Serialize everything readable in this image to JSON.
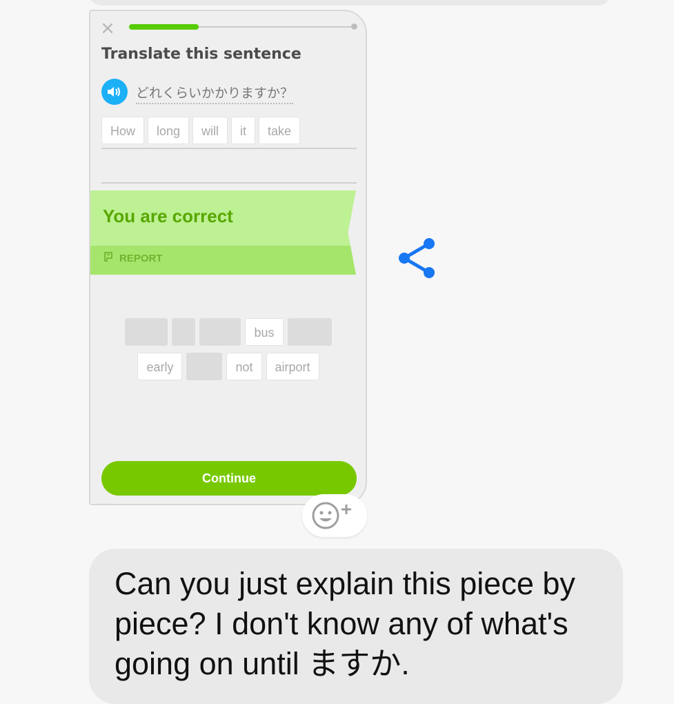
{
  "shared_screenshot": {
    "progress_fraction": 0.31,
    "prompt": "Translate this sentence",
    "japanese_sentence": "どれくらいかかりますか？",
    "answer_words": [
      "How",
      "long",
      "will",
      "it",
      "take"
    ],
    "result_text": "You are correct",
    "report_label": "REPORT",
    "word_bank_row1": [
      "",
      "",
      "",
      "bus",
      ""
    ],
    "word_bank_row2": [
      "early",
      "",
      "not",
      "airport"
    ],
    "continue_label": "Continue",
    "colors": {
      "accent_green": "#58cc02",
      "speaker_blue": "#1cb0f6",
      "banner_green": "#bdf193"
    }
  },
  "icons": {
    "close": "close-icon",
    "speaker": "speaker-icon",
    "report": "flag-icon",
    "share": "share-icon",
    "reaction": "add-reaction-icon"
  },
  "message": {
    "text": "Can you just explain this piece by piece? I don't know any of what's going on until ますか."
  },
  "share_color": "#1877f2"
}
